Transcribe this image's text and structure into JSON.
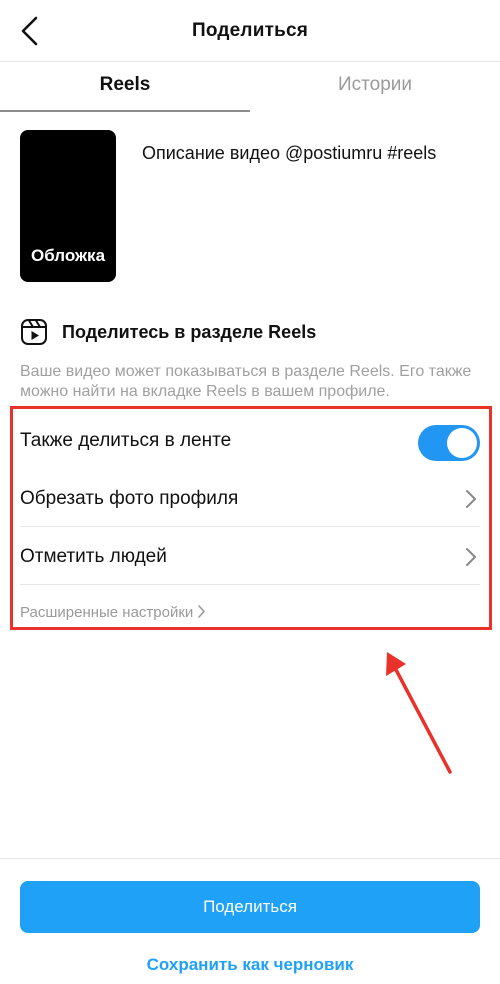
{
  "header": {
    "title": "Поделиться",
    "back_icon": "chevron-left-icon"
  },
  "tabs": [
    {
      "label": "Reels",
      "active": true
    },
    {
      "label": "Истории",
      "active": false
    }
  ],
  "post": {
    "cover_label": "Обложка",
    "caption": "Описание видео @postiumru #reels"
  },
  "reels_section": {
    "icon": "reels-icon",
    "heading": "Поделитесь в разделе Reels",
    "description": "Ваше видео может показываться в разделе Reels. Его также можно найти на вкладке Reels в вашем профиле."
  },
  "options": {
    "share_to_feed": {
      "label": "Также делиться в ленте",
      "enabled": true
    },
    "crop_profile_photo": {
      "label": "Обрезать фото профиля",
      "icon": "chevron-right-icon"
    },
    "tag_people": {
      "label": "Отметить людей",
      "icon": "chevron-right-icon"
    },
    "advanced": {
      "label": "Расширенные настройки",
      "icon": "chevron-right-icon"
    }
  },
  "annotation": {
    "highlight_color": "#e8322a",
    "arrow_color": "#e8322a"
  },
  "footer": {
    "share_button": "Поделиться",
    "save_draft": "Сохранить как черновик"
  },
  "colors": {
    "accent": "#1ea1f7",
    "toggle_on": "#2196f3",
    "muted_text": "#a0a0a0"
  }
}
